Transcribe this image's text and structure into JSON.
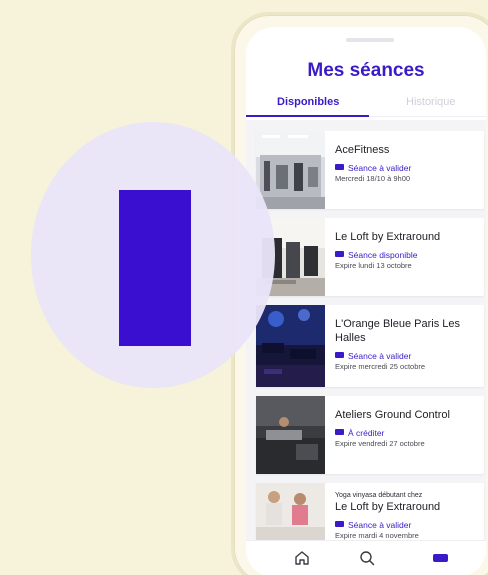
{
  "header": {
    "title": "Mes séances"
  },
  "tabs": [
    {
      "label": "Disponibles",
      "active": true
    },
    {
      "label": "Historique",
      "active": false
    }
  ],
  "sessions": [
    {
      "prefix": "",
      "venue": "AceFitness",
      "status": "Séance à valider",
      "detail": "Mercredi 18/10 à 9h00"
    },
    {
      "prefix": "",
      "venue": "Le Loft by Extraround",
      "status": "Séance disponible",
      "detail": "Expire lundi 13 octobre"
    },
    {
      "prefix": "",
      "venue": "L'Orange Bleue Paris Les Halles",
      "status": "Séance à valider",
      "detail": "Expire mercredi 25 octobre"
    },
    {
      "prefix": "",
      "venue": "Ateliers Ground Control",
      "status": "À créditer",
      "detail": "Expire vendredi 27 octobre"
    },
    {
      "prefix": "Yoga vinyasa débutant chez",
      "venue": "Le Loft by Extraround",
      "status": "Séance à valider",
      "detail": "Expire mardi 4 novembre"
    }
  ],
  "nav": {
    "items": [
      {
        "icon": "home-icon"
      },
      {
        "icon": "search-icon"
      },
      {
        "icon": "ticket-icon"
      }
    ]
  },
  "colors": {
    "background": "#F6F3DA",
    "accent": "#3B1BC7",
    "overlay_circle": "#E9E4F8",
    "overlay_bar": "#3B0FD0"
  }
}
